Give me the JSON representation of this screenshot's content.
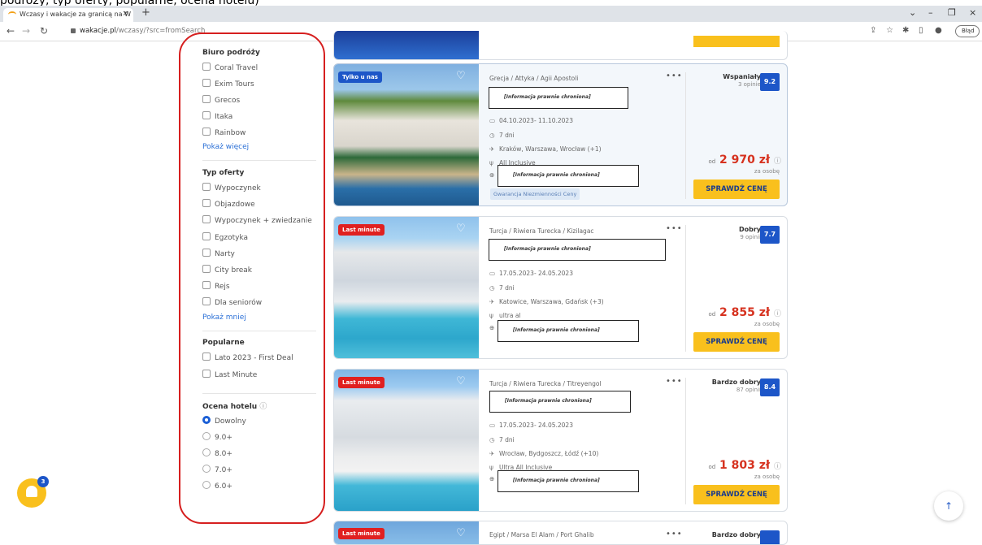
{
  "top_caption": "podróży, typ oferty, popularne, ocena hotelu)",
  "browser": {
    "tab_title": "Wczasy i wakacje za granicą na W",
    "tab_close": "×",
    "new_tab": "+",
    "url_domain": "wakacje.pl",
    "url_path": "/wczasy/?src=fromSearch",
    "error_label": "Błąd"
  },
  "filters": {
    "biuro": {
      "title": "Biuro podróży",
      "options": [
        "Coral Travel",
        "Exim Tours",
        "Grecos",
        "Itaka",
        "Rainbow"
      ],
      "more": "Pokaż więcej"
    },
    "typ": {
      "title": "Typ oferty",
      "options": [
        "Wypoczynek",
        "Objazdowe",
        "Wypoczynek + zwiedzanie",
        "Egzotyka",
        "Narty",
        "City break",
        "Rejs",
        "Dla seniorów"
      ],
      "less": "Pokaż mniej"
    },
    "popularne": {
      "title": "Popularne",
      "options": [
        "Lato 2023 - First Deal",
        "Last Minute"
      ]
    },
    "ocena": {
      "title": "Ocena hotelu",
      "options": [
        "Dowolny",
        "9.0+",
        "8.0+",
        "7.0+",
        "6.0+"
      ],
      "selected": "Dowolny"
    }
  },
  "offers": [
    {
      "badge": "Tylko u nas",
      "badge_color": "#1d56c8",
      "location": "Grecja / Attyka / Agii Apostoli",
      "legal_notice": "[Informacja prawnie chroniona]",
      "dates": "04.10.2023- 11.10.2023",
      "duration": "7 dni",
      "departure": "Kraków, Warszawa, Wrocław  (+1)",
      "board": "All Inclusive",
      "guarantee": "Gwarancja Niezmienności Ceny",
      "rating_label": "Wspaniały",
      "reviews": "3 opinie",
      "score": "9.2",
      "price_prefix": "od",
      "price": "2 970 zł",
      "per_person": "za osobę",
      "cta": "SPRAWDŹ CENĘ"
    },
    {
      "badge": "Last minute",
      "badge_color": "#e02020",
      "location": "Turcja / Riwiera Turecka / Kizilagac",
      "legal_notice": "[Informacja prawnie chroniona]",
      "dates": "17.05.2023- 24.05.2023",
      "duration": "7 dni",
      "departure": "Katowice, Warszawa, Gdańsk  (+3)",
      "board": "ultra al",
      "rating_label": "Dobry",
      "reviews": "9 opinii",
      "score": "7.7",
      "price_prefix": "od",
      "price": "2 855 zł",
      "per_person": "za osobę",
      "cta": "SPRAWDŹ CENĘ"
    },
    {
      "badge": "Last minute",
      "badge_color": "#e02020",
      "location": "Turcja / Riwiera Turecka / Titreyengol",
      "legal_notice": "[Informacja prawnie chroniona]",
      "dates": "17.05.2023- 24.05.2023",
      "duration": "7 dni",
      "departure": "Wrocław, Bydgoszcz, Łódź  (+10)",
      "board": "Ultra All Inclusive",
      "rating_label": "Bardzo dobry",
      "reviews": "87 opinii",
      "score": "8.4",
      "price_prefix": "od",
      "price": "1 803 zł",
      "per_person": "za osobę",
      "cta": "SPRAWDŹ CENĘ"
    },
    {
      "badge": "Last minute",
      "location": "Egipt / Marsa El Alam / Port Ghalib",
      "rating_label": "Bardzo dobry"
    }
  ],
  "notifications_count": "3",
  "colors": {
    "accent_blue": "#1d56c8",
    "price_red": "#d6321f",
    "cta_yellow": "#f9c01d",
    "highlight_border": "#d61f1f"
  }
}
